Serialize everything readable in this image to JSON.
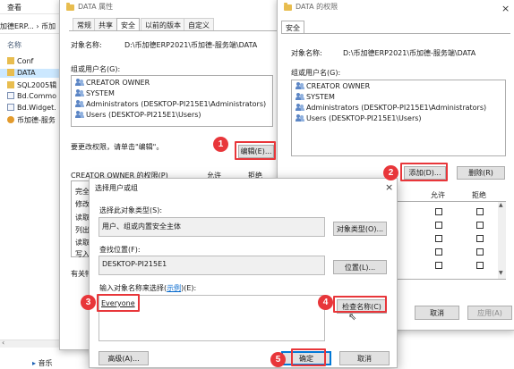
{
  "explorer": {
    "menu_view": "查看",
    "breadcrumb": "加德ERP... › 币加",
    "col_name": "名称",
    "items": [
      {
        "label": "Conf",
        "icon": "folder-icon"
      },
      {
        "label": "DATA",
        "icon": "folder-icon"
      },
      {
        "label": "SQL2005辑",
        "icon": "folder-icon"
      },
      {
        "label": "Bd.Commo",
        "icon": "file-icon"
      },
      {
        "label": "Bd.Widget.",
        "icon": "file-icon"
      },
      {
        "label": "币加德-服务",
        "icon": "app-icon"
      }
    ],
    "bottom_item": "音乐"
  },
  "props": {
    "title": "DATA 属性",
    "tabs": [
      "常规",
      "共享",
      "安全",
      "以前的版本",
      "自定义"
    ],
    "object_label": "对象名称:",
    "object_value": "D:\\币加德ERP2021\\币加德-服务端\\DATA",
    "group_label": "组或用户名(G):",
    "users": [
      "CREATOR OWNER",
      "SYSTEM",
      "Administrators (DESKTOP-PI215E1\\Administrators)",
      "Users (DESKTOP-PI215E1\\Users)"
    ],
    "change_hint": "要更改权限，请单击\"编辑\"。",
    "edit_button": "编辑(E)...",
    "perm_label": "CREATOR OWNER 的权限(P)",
    "allow": "允许",
    "deny": "拒绝",
    "perm_partials": [
      "完全",
      "修改",
      "读取",
      "列出",
      "读取",
      "写入"
    ],
    "more_prefix": "有关特"
  },
  "perms": {
    "title": "DATA 的权限",
    "tab": "安全",
    "object_label": "对象名称:",
    "object_value": "D:\\币加德ERP2021\\币加德-服务端\\DATA",
    "group_label": "组或用户名(G):",
    "users": [
      "CREATOR OWNER",
      "SYSTEM",
      "Administrators (DESKTOP-PI215E1\\Administrators)",
      "Users (DESKTOP-PI215E1\\Users)"
    ],
    "add_button": "添加(D)...",
    "remove_button": "删除(R)",
    "allow": "允许",
    "deny": "拒绝",
    "cancel_button": "取消",
    "apply_button": "应用(A)"
  },
  "select": {
    "title": "选择用户或组",
    "type_label": "选择此对象类型(S):",
    "type_value": "用户、组或内置安全主体",
    "type_button": "对象类型(O)...",
    "location_label": "查找位置(F):",
    "location_value": "DESKTOP-PI215E1",
    "location_button": "位置(L)...",
    "enter_label_prefix": "输入对象名称来选择(",
    "enter_label_link": "示例",
    "enter_label_suffix": ")(E):",
    "entered_value": "Everyone",
    "check_button": "检查名称(C)",
    "advanced_button": "高级(A)...",
    "ok_button": "确定",
    "cancel_button": "取消"
  },
  "badges": [
    "1",
    "2",
    "3",
    "4",
    "5"
  ]
}
